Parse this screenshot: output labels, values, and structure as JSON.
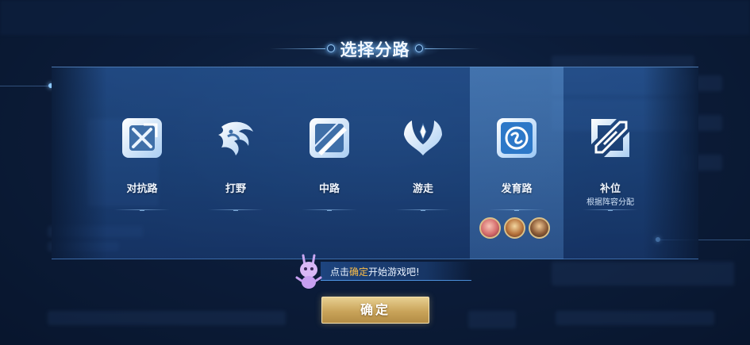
{
  "title": "选择分路",
  "roles": [
    {
      "label": "对抗路",
      "sub": "",
      "icon": "crossed-swords-icon",
      "selected": false
    },
    {
      "label": "打野",
      "sub": "",
      "icon": "dragon-icon",
      "selected": false
    },
    {
      "label": "中路",
      "sub": "",
      "icon": "mid-lane-blade-icon",
      "selected": false
    },
    {
      "label": "游走",
      "sub": "",
      "icon": "wings-icon",
      "selected": false
    },
    {
      "label": "发育路",
      "sub": "",
      "icon": "marksman-icon",
      "selected": true
    },
    {
      "label": "补位",
      "sub": "根据阵容分配",
      "icon": "fill-swap-icon",
      "selected": false
    }
  ],
  "hint": {
    "prefix": "点击",
    "highlight": "确定",
    "suffix": "开始游戏吧!"
  },
  "confirm_label": "确定",
  "colors": {
    "accent_gold": "#c9a45a",
    "hint_highlight": "#ffbf47",
    "panel_blue": "#2f5f9f"
  }
}
